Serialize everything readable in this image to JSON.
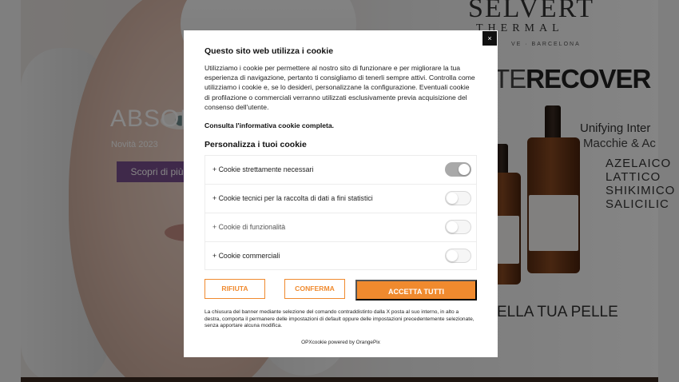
{
  "hero": {
    "title": "ABSOL",
    "subtitle": "Novità 2023",
    "cta": "Scopri di più..."
  },
  "brand": {
    "name": "SELVERT",
    "tagline": "THERMAL",
    "location": "VE · BARCELONA",
    "product_line_a": "TE",
    "product_line_b": "RECOVER",
    "claim_1": "Unifying Inter",
    "claim_2": "Macchie & Ac",
    "ingredients": [
      "AZELAICO",
      "LATTICO",
      "SHIKIMICO",
      "SALICILIC"
    ],
    "bottom_claim": "ELLA TUA PELLE"
  },
  "cookie_dialog": {
    "close_label": "×",
    "title": "Questo sito web utilizza i cookie",
    "body": "Utilizziamo i cookie per permettere al nostro sito di funzionare e per migliorare la tua esperienza di navigazione, pertanto ti consigliamo di tenerli sempre attivi. Controlla come utilizziamo i cookie e, se lo desideri, personalizzane la configurazione. Eventuali cookie di profilazione o commerciali verranno utilizzati esclusivamente previa acquisizione del consenso dell'utente.",
    "policy_link": "Consulta l'informativa cookie completa.",
    "customize_title": "Personalizza i tuoi cookie",
    "categories": [
      {
        "label": "+ Cookie strettamente necessari",
        "enabled": true
      },
      {
        "label": "+ Cookie tecnici per la raccolta di dati a fini statistici",
        "enabled": false
      },
      {
        "label": "+ Cookie di funzionalità",
        "enabled": false
      },
      {
        "label": "+ Cookie commerciali",
        "enabled": false
      }
    ],
    "buttons": {
      "reject": "RIFIUTA",
      "confirm": "CONFERMA",
      "accept_all": "ACCETTA TUTTI"
    },
    "footer_note": "La chiusura del banner mediante selezione del comando contraddistinto dalla X posta al suo interno, in alto a destra, comporta il permanere delle impostazioni di default oppure delle impostazioni precedentemente selezionate, senza apportare alcuna modifica.",
    "powered_by": "OPXcookie powered by OrangePix"
  },
  "colors": {
    "accent": "#f08a2e",
    "hero_button": "#7a4f8e",
    "toggle_on": "#a9a9a9"
  }
}
